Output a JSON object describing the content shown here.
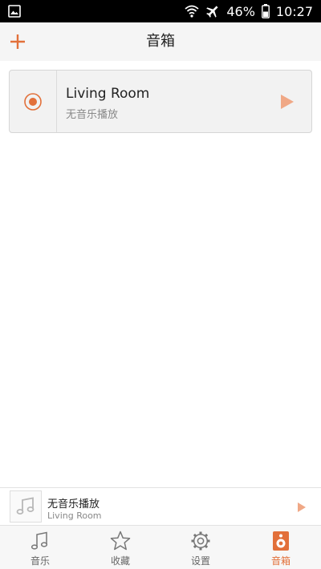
{
  "status_bar": {
    "battery": "46%",
    "time": "10:27",
    "icons": [
      "image-icon",
      "wifi-icon",
      "airplane-icon",
      "battery-icon"
    ]
  },
  "header": {
    "title": "音箱",
    "add_icon": "plus-icon"
  },
  "speakers": [
    {
      "name": "Living Room",
      "status": "无音乐播放",
      "selected": true
    }
  ],
  "mini_player": {
    "title": "无音乐播放",
    "subtitle": "Living Room",
    "cover_icon": "music-note-icon"
  },
  "tabs": [
    {
      "label": "音乐",
      "icon": "music-note-icon",
      "active": false
    },
    {
      "label": "收藏",
      "icon": "star-icon",
      "active": false
    },
    {
      "label": "设置",
      "icon": "gear-icon",
      "active": false
    },
    {
      "label": "音箱",
      "icon": "speaker-icon",
      "active": true
    }
  ],
  "colors": {
    "accent": "#e2703a",
    "play_light": "#f0a886",
    "header_bg": "#f5f5f5",
    "card_bg": "#f2f2f2"
  }
}
